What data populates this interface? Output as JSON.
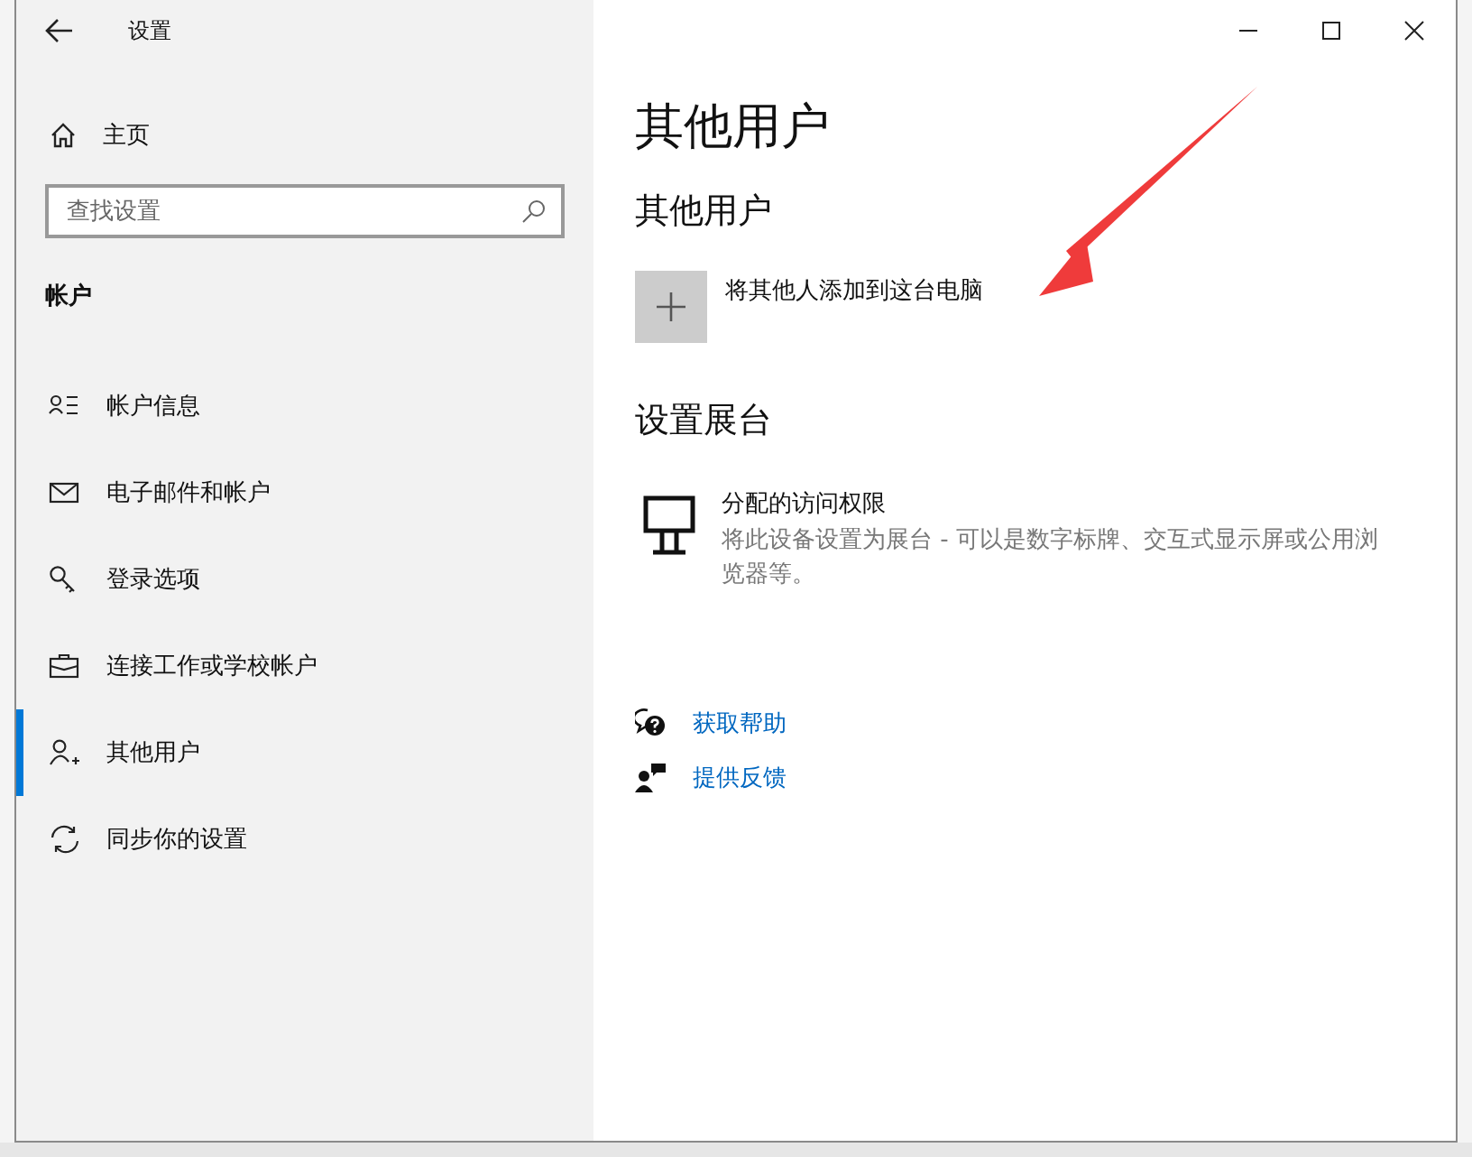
{
  "window": {
    "title": "设置"
  },
  "sidebar": {
    "home": "主页",
    "search": {
      "placeholder": "查找设置"
    },
    "section": "帐户",
    "items": [
      {
        "label": "帐户信息",
        "kind": "info",
        "selected": false
      },
      {
        "label": "电子邮件和帐户",
        "kind": "mail",
        "selected": false
      },
      {
        "label": "登录选项",
        "kind": "key",
        "selected": false
      },
      {
        "label": "连接工作或学校帐户",
        "kind": "briefcase",
        "selected": false
      },
      {
        "label": "其他用户",
        "kind": "adduser",
        "selected": true
      },
      {
        "label": "同步你的设置",
        "kind": "sync",
        "selected": false
      }
    ]
  },
  "main": {
    "title": "其他用户",
    "section1": {
      "heading": "其他用户",
      "add_label": "将其他人添加到这台电脑"
    },
    "section2": {
      "heading": "设置展台",
      "item_title": "分配的访问权限",
      "item_desc": "将此设备设置为展台 - 可以是数字标牌、交互式显示屏或公用浏览器等。"
    },
    "links": [
      {
        "label": "获取帮助",
        "kind": "help"
      },
      {
        "label": "提供反馈",
        "kind": "feedback"
      }
    ]
  },
  "annotation": {
    "kind": "arrow"
  }
}
